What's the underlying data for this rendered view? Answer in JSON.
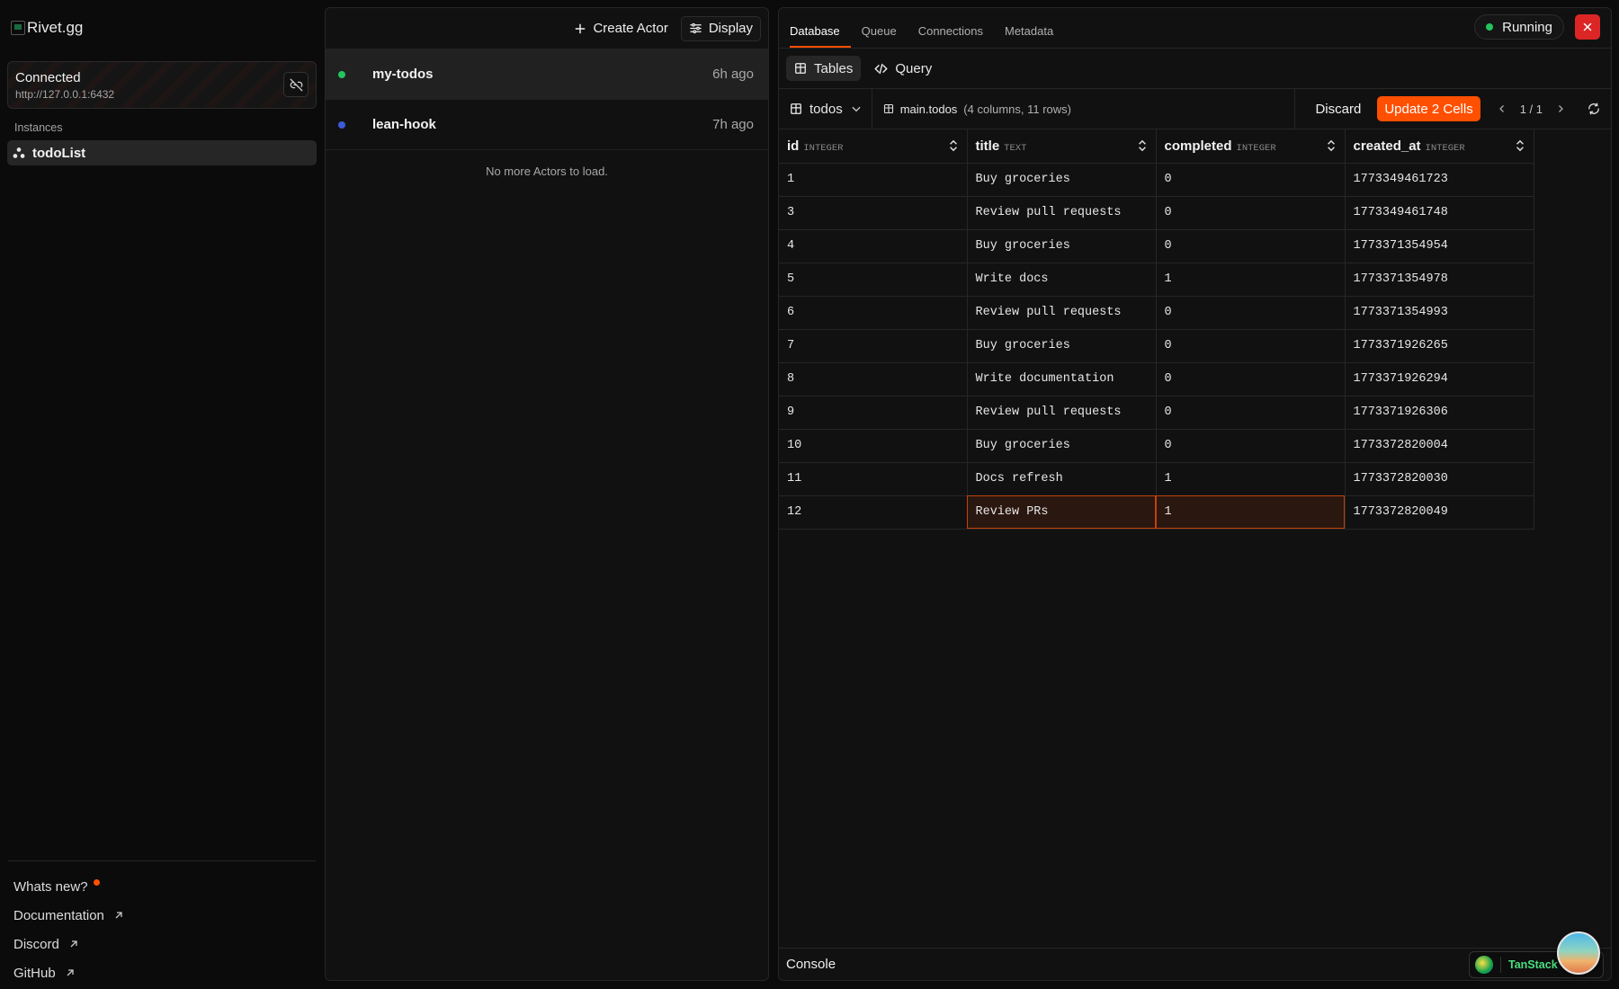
{
  "sidebar": {
    "logo_alt": "Rivet.gg",
    "connection": {
      "status": "Connected",
      "url": "http://127.0.0.1:6432"
    },
    "instances_label": "Instances",
    "instances": [
      {
        "label": "todoList"
      }
    ],
    "footer_links": [
      {
        "label": "Whats new?"
      },
      {
        "label": "Documentation"
      },
      {
        "label": "Discord"
      },
      {
        "label": "GitHub"
      }
    ]
  },
  "actors": {
    "toolbar": {
      "create_label": "Create Actor",
      "display_label": "Display"
    },
    "items": [
      {
        "name": "my-todos",
        "time": "6h ago",
        "dot_color": "#22c55e"
      },
      {
        "name": "lean-hook",
        "time": "7h ago",
        "dot_color": "#3b5bdb"
      }
    ],
    "empty_text": "No more Actors to load."
  },
  "database": {
    "tabs": [
      {
        "label": "Database"
      },
      {
        "label": "Queue"
      },
      {
        "label": "Connections"
      },
      {
        "label": "Metadata"
      }
    ],
    "status": "Running",
    "subtabs": {
      "tables_label": "Tables",
      "query_label": "Query"
    },
    "table_select": "todos",
    "table_name": "main.todos",
    "table_meta": "(4 columns, 11 rows)",
    "discard_label": "Discard",
    "update_label": "Update 2 Cells",
    "pagination": "1 / 1",
    "columns": [
      {
        "name": "id",
        "type": "INTEGER"
      },
      {
        "name": "title",
        "type": "TEXT"
      },
      {
        "name": "completed",
        "type": "INTEGER"
      },
      {
        "name": "created_at",
        "type": "INTEGER"
      }
    ],
    "rows": [
      [
        "1",
        "Buy groceries",
        "0",
        "1773349461723"
      ],
      [
        "3",
        "Review pull requests",
        "0",
        "1773349461748"
      ],
      [
        "4",
        "Buy groceries",
        "0",
        "1773371354954"
      ],
      [
        "5",
        "Write docs",
        "1",
        "1773371354978"
      ],
      [
        "6",
        "Review pull requests",
        "0",
        "1773371354993"
      ],
      [
        "7",
        "Buy groceries",
        "0",
        "1773371926265"
      ],
      [
        "8",
        "Write documentation",
        "0",
        "1773371926294"
      ],
      [
        "9",
        "Review pull requests",
        "0",
        "1773371926306"
      ],
      [
        "10",
        "Buy groceries",
        "0",
        "1773372820004"
      ],
      [
        "11",
        "Docs refresh",
        "1",
        "1773372820030"
      ],
      [
        "12",
        "Review PRs",
        "1",
        "1773372820049"
      ]
    ],
    "edited_cells": [
      [
        10,
        1
      ],
      [
        10,
        2
      ]
    ],
    "console_label": "Console",
    "tanstack_label": "TanStack"
  }
}
